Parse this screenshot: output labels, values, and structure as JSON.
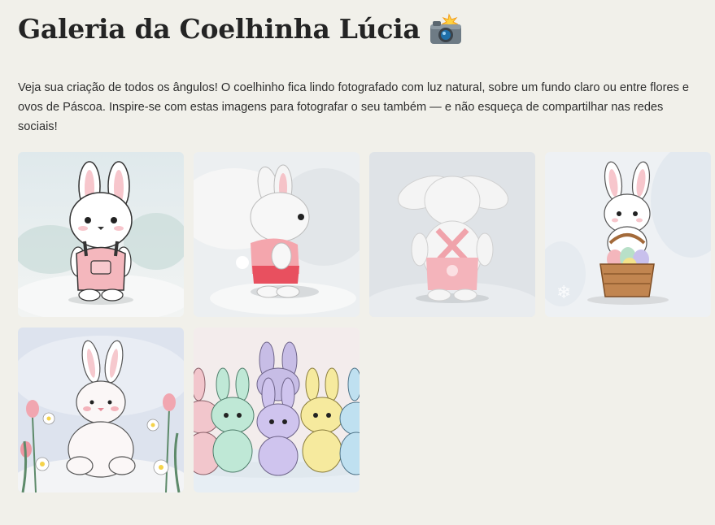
{
  "header": {
    "title": "Galeria da Coelhinha Lúcia",
    "title_icon": "camera-flash-icon"
  },
  "intro": {
    "text": "Veja sua criação de todos os ângulos! O coelhinho fica lindo fotografado com luz natural, sobre um fundo claro ou entre flores e ovos de Páscoa. Inspire-se com estas imagens para fotografar o seu também — e não esqueça de compartilhar nas redes sociais!"
  },
  "gallery": {
    "images": [
      {
        "scene": "front-view-overalls"
      },
      {
        "scene": "side-view-pink-shirt"
      },
      {
        "scene": "back-view-overalls"
      },
      {
        "scene": "bunny-with-easter-basket"
      },
      {
        "scene": "bunny-with-tulips"
      },
      {
        "scene": "pastel-bunny-group"
      }
    ]
  },
  "colors": {
    "background": "#f1f0ea",
    "title": "#242424",
    "overalls_pink": "#f4b7bd"
  }
}
